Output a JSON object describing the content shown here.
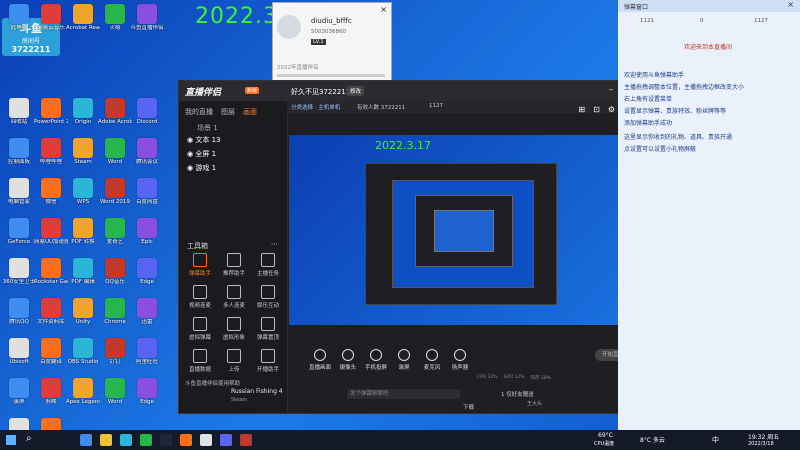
{
  "overlay": {
    "date": "2022.3.17",
    "stream_logo_top": "斗鱼",
    "stream_logo_sub": "房间号",
    "room_number": "3722211"
  },
  "desktop_icons": [
    {
      "label": "此电脑"
    },
    {
      "label": "网易云音乐"
    },
    {
      "label": "Acrobat Reader"
    },
    {
      "label": "火绒"
    },
    {
      "label": "斗鱼直播伴侣"
    },
    {
      "label": "回收站"
    },
    {
      "label": "PowerPoint 2019"
    },
    {
      "label": "Origin"
    },
    {
      "label": "Adobe Acrobat"
    },
    {
      "label": "Discord"
    },
    {
      "label": "控制面板"
    },
    {
      "label": "哔哩哔哩"
    },
    {
      "label": "Steam"
    },
    {
      "label": "Word"
    },
    {
      "label": "腾讯会议"
    },
    {
      "label": "电脑管家"
    },
    {
      "label": "微信"
    },
    {
      "label": "WPS"
    },
    {
      "label": "Word 2019"
    },
    {
      "label": "百度网盘"
    },
    {
      "label": "GeForce"
    },
    {
      "label": "网易UU加速器"
    },
    {
      "label": "PDF 转换"
    },
    {
      "label": "爱奇艺"
    },
    {
      "label": "Epic"
    },
    {
      "label": "360安全卫士"
    },
    {
      "label": "Rockstar Games"
    },
    {
      "label": "PDF 编辑"
    },
    {
      "label": "QQ音乐"
    },
    {
      "label": "Edge"
    },
    {
      "label": "腾讯QQ"
    },
    {
      "label": "文件资料库"
    },
    {
      "label": "Unity"
    },
    {
      "label": "Chrome"
    },
    {
      "label": "迅雷"
    },
    {
      "label": "Ubisoft"
    },
    {
      "label": "百度翻译"
    },
    {
      "label": "OBS Studio"
    },
    {
      "label": "钉钉"
    },
    {
      "label": "阿里旺旺"
    },
    {
      "label": "录屏"
    },
    {
      "label": "剪映"
    },
    {
      "label": "Apex Legends"
    },
    {
      "label": "Word"
    },
    {
      "label": "Edge"
    },
    {
      "label": "QQ影音"
    },
    {
      "label": "图片"
    }
  ],
  "profile": {
    "username": "diudiu_bfffc",
    "id": "5003036860",
    "level": "LV.1",
    "footer": "2022年直播伴侣"
  },
  "app": {
    "logo": "直播伴侣",
    "logo_badge": "新版",
    "room_title": "好久不见3722211",
    "edit_label": "修改",
    "category_label": "分类选择 · 主机单机",
    "viewers_label": "有效人数 3722211",
    "followers": "1127",
    "tabs": [
      "我的直播",
      "图层",
      "画面"
    ],
    "scene_header": "场景 1",
    "layers": [
      "文本 13",
      "全屏 1",
      "游戏 1"
    ],
    "toolbox_title": "工具箱",
    "tools": [
      "弹幕助手",
      "推荐助手",
      "主播任务",
      "视频连麦",
      "多人连麦",
      "娱乐互动",
      "虚拟弹幕",
      "虚拟形象",
      "弹幕置顶",
      "直播数据",
      "上传",
      "开播助手"
    ],
    "bottom_notice": "斗鱼直播伴侣使用帮助",
    "controls": [
      "直播画面",
      "摄像头",
      "手机投屏",
      "录屏",
      "麦克风",
      "扬声器"
    ],
    "start_button": "开始直播",
    "game_label": "Russian Fishing 4",
    "game_sub": "Steam",
    "chat_placeholder": "发个弹幕聊聊吧",
    "gift_label": "1 仅好友赠送",
    "download_label": "下载",
    "stats": [
      "CPU 32%",
      "GPU 12%",
      "内存 58%",
      "帧率 60",
      "码率 0kb/s"
    ],
    "fan_label": "王大头"
  },
  "chat": {
    "header": "弹幕窗口",
    "counts": [
      "1121",
      "0",
      "1127"
    ],
    "highlight": "欢迎来到本直播间",
    "messages": [
      "欢迎使用斗鱼弹幕助手",
      "主播拖拽调整本位置，主播拖拽边框改变大小",
      "右上角有设置菜单",
      "设置显示弹幕、贵族特效、粉丝牌等等",
      "添加弹幕助手成功",
      "这里显示你收到的礼物、道具、贵族开通",
      "点设置可以设置小礼物屏蔽"
    ]
  },
  "taskbar": {
    "search_placeholder": "搜索",
    "weather": "8°C 多云",
    "cpu_temp": "69°C",
    "cpu_label": "CPU温度",
    "time": "19:32 周五",
    "date": "2022/3/18",
    "lang": "中"
  }
}
